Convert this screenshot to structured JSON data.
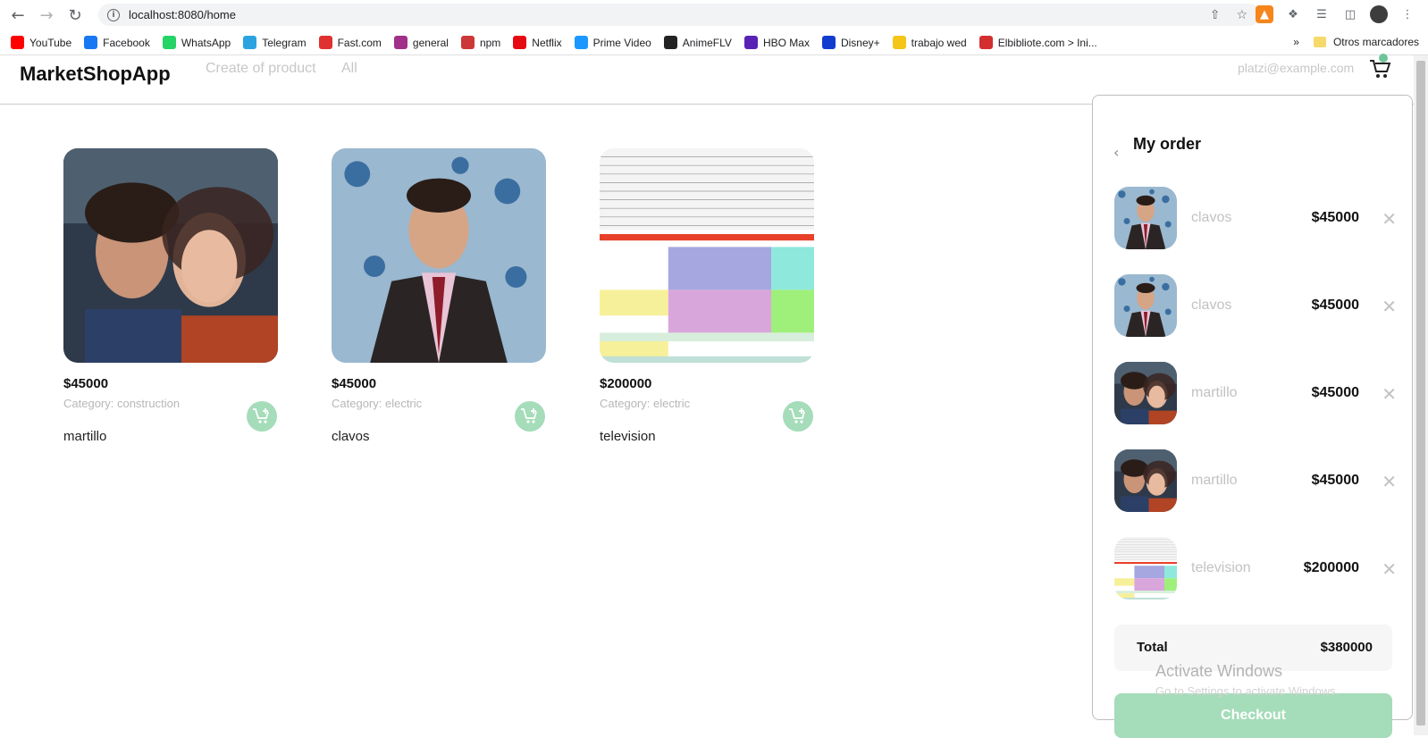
{
  "browser": {
    "url": "localhost:8080/home",
    "bookmarks": [
      {
        "label": "YouTube",
        "color": "#ff0000"
      },
      {
        "label": "Facebook",
        "color": "#1877f2"
      },
      {
        "label": "WhatsApp",
        "color": "#25d366"
      },
      {
        "label": "Telegram",
        "color": "#2aa3e0"
      },
      {
        "label": "Fast.com",
        "color": "#e03030"
      },
      {
        "label": "general",
        "color": "#a03088"
      },
      {
        "label": "npm",
        "color": "#cb3837"
      },
      {
        "label": "Netflix",
        "color": "#e50914"
      },
      {
        "label": "Prime Video",
        "color": "#1a98ff"
      },
      {
        "label": "AnimeFLV",
        "color": "#222222"
      },
      {
        "label": "HBO Max",
        "color": "#5822b4"
      },
      {
        "label": "Disney+",
        "color": "#113ccf"
      },
      {
        "label": "trabajo wed",
        "color": "#f5c518"
      },
      {
        "label": "Elbibliote.com > Ini...",
        "color": "#d32f2f"
      }
    ],
    "more_bookmarks": "»",
    "other_bookmarks": "Otros marcadores"
  },
  "header": {
    "brand": "MarketShopApp",
    "nav": [
      "Create of product",
      "All"
    ],
    "email": "platzi@example.com"
  },
  "products": [
    {
      "price": "$45000",
      "category": "Category: construction",
      "name": "martillo",
      "image": "couple-photo"
    },
    {
      "price": "$45000",
      "category": "Category: electric",
      "name": "clavos",
      "image": "man-suit-photo"
    },
    {
      "price": "$200000",
      "category": "Category: electric",
      "name": "television",
      "image": "schedule-table"
    }
  ],
  "order": {
    "title": "My order",
    "items": [
      {
        "name": "clavos",
        "price": "$45000",
        "image": "man-suit-photo"
      },
      {
        "name": "clavos",
        "price": "$45000",
        "image": "man-suit-photo"
      },
      {
        "name": "martillo",
        "price": "$45000",
        "image": "couple-photo"
      },
      {
        "name": "martillo",
        "price": "$45000",
        "image": "couple-photo"
      },
      {
        "name": "television",
        "price": "$200000",
        "image": "schedule-table"
      }
    ],
    "total_label": "Total",
    "total_value": "$380000",
    "checkout_label": "Checkout"
  },
  "watermark": {
    "line1": "Activate Windows",
    "line2": "Go to Settings to activate Windows."
  },
  "colors": {
    "accent": "#a5dcb9",
    "muted": "#c2c2c2"
  }
}
